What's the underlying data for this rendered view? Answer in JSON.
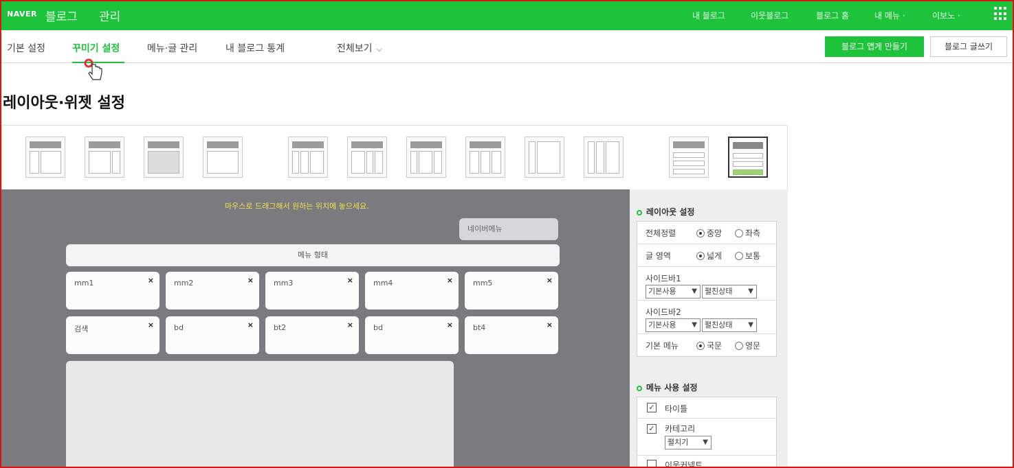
{
  "header": {
    "logo": "NAVER",
    "blog": "블로그",
    "admin": "관리",
    "nav": [
      "내 블로그",
      "이웃블로그",
      "블로그 홈",
      "내 메뉴 ·",
      "이보노 ·"
    ],
    "apps_icon": "grid-icon"
  },
  "subnav": {
    "tabs": [
      "기본 설정",
      "꾸미기 설정",
      "메뉴·글 관리",
      "내 블로그 통계"
    ],
    "view_all": "전체보기",
    "active_index": 1,
    "btn_make": "블로그 앱게 만들기",
    "btn_write": "블로그 글쓰기"
  },
  "page_title": "레이아웃·위젯 설정",
  "editor": {
    "hint": "마우스로 드래그해서 원하는 위치에 놓으세요.",
    "pill": "네이버메뉴",
    "menubar": "메뉴 형태",
    "widgets_row1": [
      "mm1",
      "mm2",
      "mm3",
      "mm4",
      "mm5"
    ],
    "widgets_row2": [
      "검색",
      "bd",
      "bt2",
      "bd",
      "bt4"
    ],
    "close": "×"
  },
  "panel": {
    "layout_title": "레이아웃 설정",
    "align_label": "전체정렬",
    "align_opts": [
      "중앙",
      "좌측"
    ],
    "area_label": "글 영역",
    "area_opts": [
      "넓게",
      "보통"
    ],
    "side1_label": "사이드바1",
    "side2_label": "사이드바2",
    "side_sel1": "기본사용",
    "side_sel2": "펼친상태",
    "basic_menu_label": "기본 메뉴",
    "basic_menu_opts": [
      "국문",
      "영문"
    ],
    "menu_title": "메뉴 사용 설정",
    "menu_items": [
      "타이틀",
      "카테고리"
    ],
    "menu_sel": "펼치기",
    "menu_item3": "이웃커넥트"
  },
  "colors": {
    "accent": "#1dc33b",
    "editor_bg": "#7a7a7f",
    "hint": "#f1e04c"
  }
}
